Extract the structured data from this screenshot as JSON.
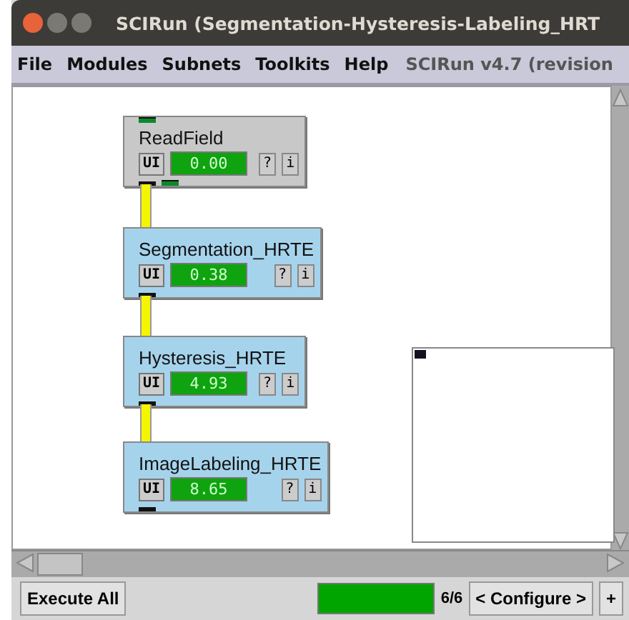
{
  "window": {
    "title": "SCIRun (Segmentation-Hysteresis-Labeling_HRT"
  },
  "menu": [
    {
      "label": "File"
    },
    {
      "label": "Modules"
    },
    {
      "label": "Subnets"
    },
    {
      "label": "Toolkits"
    },
    {
      "label": "Help"
    }
  ],
  "version": "SCIRun v4.7 (revision",
  "modules": [
    {
      "name": "ReadField",
      "time": "0.00",
      "color": "#c8c8c8",
      "field_ports": true,
      "ui": "UI",
      "help": "?",
      "info": "i"
    },
    {
      "name": "Segmentation_HRTE",
      "time": "0.38",
      "color": "#a6d3ec",
      "field_ports": false,
      "ui": "UI",
      "help": "?",
      "info": "i"
    },
    {
      "name": "Hysteresis_HRTE",
      "time": "4.93",
      "color": "#a6d3ec",
      "field_ports": false,
      "ui": "UI",
      "help": "?",
      "info": "i"
    },
    {
      "name": "ImageLabeling_HRTE",
      "time": "8.65",
      "color": "#a6d3ec",
      "field_ports": false,
      "ui": "UI",
      "help": "?",
      "info": "i"
    }
  ],
  "bottom": {
    "execute": "Execute All",
    "progress": {
      "level": 1.0
    },
    "count": "6/6",
    "configure": "< Configure >",
    "plus": "+"
  }
}
